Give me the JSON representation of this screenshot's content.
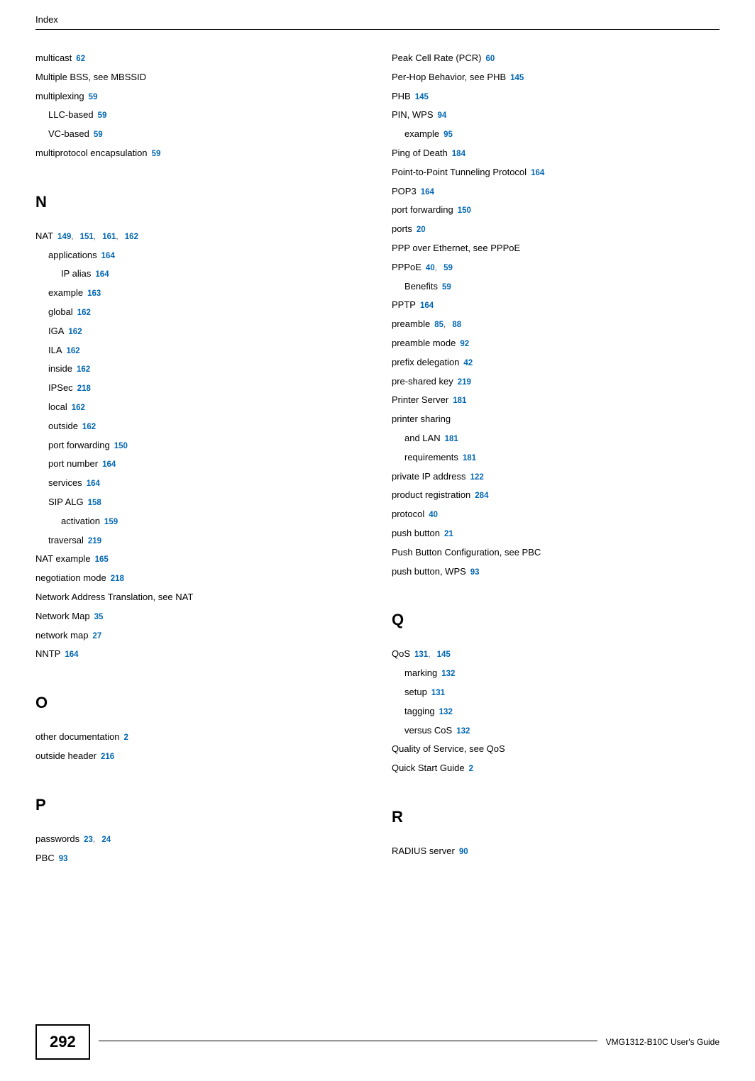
{
  "header": "Index",
  "footer": {
    "pageNumber": "292",
    "guide": "VMG1312-B10C User's Guide"
  },
  "leftColumn": [
    {
      "text": "multicast",
      "pages": [
        "62"
      ],
      "indent": 0
    },
    {
      "text": "Multiple BSS, see MBSSID",
      "pages": [],
      "indent": 0
    },
    {
      "text": "multiplexing",
      "pages": [
        "59"
      ],
      "indent": 0
    },
    {
      "text": "LLC-based",
      "pages": [
        "59"
      ],
      "indent": 1
    },
    {
      "text": "VC-based",
      "pages": [
        "59"
      ],
      "indent": 1
    },
    {
      "text": "multiprotocol encapsulation",
      "pages": [
        "59"
      ],
      "indent": 0
    },
    {
      "type": "letter",
      "text": "N"
    },
    {
      "text": "NAT",
      "pages": [
        "149",
        "151",
        "161",
        "162"
      ],
      "indent": 0
    },
    {
      "text": "applications",
      "pages": [
        "164"
      ],
      "indent": 1
    },
    {
      "text": "IP alias",
      "pages": [
        "164"
      ],
      "indent": 2
    },
    {
      "text": "example",
      "pages": [
        "163"
      ],
      "indent": 1
    },
    {
      "text": "global",
      "pages": [
        "162"
      ],
      "indent": 1
    },
    {
      "text": "IGA",
      "pages": [
        "162"
      ],
      "indent": 1
    },
    {
      "text": "ILA",
      "pages": [
        "162"
      ],
      "indent": 1
    },
    {
      "text": "inside",
      "pages": [
        "162"
      ],
      "indent": 1
    },
    {
      "text": "IPSec",
      "pages": [
        "218"
      ],
      "indent": 1
    },
    {
      "text": "local",
      "pages": [
        "162"
      ],
      "indent": 1
    },
    {
      "text": "outside",
      "pages": [
        "162"
      ],
      "indent": 1
    },
    {
      "text": "port forwarding",
      "pages": [
        "150"
      ],
      "indent": 1
    },
    {
      "text": "port number",
      "pages": [
        "164"
      ],
      "indent": 1
    },
    {
      "text": "services",
      "pages": [
        "164"
      ],
      "indent": 1
    },
    {
      "text": "SIP ALG",
      "pages": [
        "158"
      ],
      "indent": 1
    },
    {
      "text": "activation",
      "pages": [
        "159"
      ],
      "indent": 2
    },
    {
      "text": "traversal",
      "pages": [
        "219"
      ],
      "indent": 1
    },
    {
      "text": "NAT example",
      "pages": [
        "165"
      ],
      "indent": 0
    },
    {
      "text": "negotiation mode",
      "pages": [
        "218"
      ],
      "indent": 0
    },
    {
      "text": "Network Address Translation, see NAT",
      "pages": [],
      "indent": 0
    },
    {
      "text": "Network Map",
      "pages": [
        "35"
      ],
      "indent": 0
    },
    {
      "text": "network map",
      "pages": [
        "27"
      ],
      "indent": 0
    },
    {
      "text": "NNTP",
      "pages": [
        "164"
      ],
      "indent": 0
    },
    {
      "type": "letter",
      "text": "O"
    },
    {
      "text": "other documentation",
      "pages": [
        "2"
      ],
      "indent": 0
    },
    {
      "text": "outside header",
      "pages": [
        "216"
      ],
      "indent": 0
    },
    {
      "type": "letter",
      "text": "P"
    },
    {
      "text": "passwords",
      "pages": [
        "23",
        "24"
      ],
      "indent": 0
    },
    {
      "text": "PBC",
      "pages": [
        "93"
      ],
      "indent": 0
    }
  ],
  "rightColumn": [
    {
      "text": "Peak Cell Rate (PCR)",
      "pages": [
        "60"
      ],
      "indent": 0
    },
    {
      "text": "Per-Hop Behavior, see PHB",
      "pages": [
        "145"
      ],
      "indent": 0
    },
    {
      "text": "PHB",
      "pages": [
        "145"
      ],
      "indent": 0
    },
    {
      "text": "PIN, WPS",
      "pages": [
        "94"
      ],
      "indent": 0
    },
    {
      "text": "example",
      "pages": [
        "95"
      ],
      "indent": 1
    },
    {
      "text": "Ping of Death",
      "pages": [
        "184"
      ],
      "indent": 0
    },
    {
      "text": "Point-to-Point Tunneling Protocol",
      "pages": [
        "164"
      ],
      "indent": 0
    },
    {
      "text": "POP3",
      "pages": [
        "164"
      ],
      "indent": 0
    },
    {
      "text": "port forwarding",
      "pages": [
        "150"
      ],
      "indent": 0
    },
    {
      "text": "ports",
      "pages": [
        "20"
      ],
      "indent": 0
    },
    {
      "text": "PPP over Ethernet, see PPPoE",
      "pages": [],
      "indent": 0
    },
    {
      "text": "PPPoE",
      "pages": [
        "40",
        "59"
      ],
      "indent": 0
    },
    {
      "text": "Benefits",
      "pages": [
        "59"
      ],
      "indent": 1
    },
    {
      "text": "PPTP",
      "pages": [
        "164"
      ],
      "indent": 0
    },
    {
      "text": "preamble",
      "pages": [
        "85",
        "88"
      ],
      "indent": 0
    },
    {
      "text": "preamble mode",
      "pages": [
        "92"
      ],
      "indent": 0
    },
    {
      "text": "prefix delegation",
      "pages": [
        "42"
      ],
      "indent": 0
    },
    {
      "text": "pre-shared key",
      "pages": [
        "219"
      ],
      "indent": 0
    },
    {
      "text": "Printer Server",
      "pages": [
        "181"
      ],
      "indent": 0
    },
    {
      "text": "printer sharing",
      "pages": [],
      "indent": 0
    },
    {
      "text": "and LAN",
      "pages": [
        "181"
      ],
      "indent": 1
    },
    {
      "text": "requirements",
      "pages": [
        "181"
      ],
      "indent": 1
    },
    {
      "text": "private IP address",
      "pages": [
        "122"
      ],
      "indent": 0
    },
    {
      "text": "product registration",
      "pages": [
        "284"
      ],
      "indent": 0
    },
    {
      "text": "protocol",
      "pages": [
        "40"
      ],
      "indent": 0
    },
    {
      "text": "push button",
      "pages": [
        "21"
      ],
      "indent": 0
    },
    {
      "text": "Push Button Configuration, see PBC",
      "pages": [],
      "indent": 0
    },
    {
      "text": "push button, WPS",
      "pages": [
        "93"
      ],
      "indent": 0
    },
    {
      "type": "letter",
      "text": "Q"
    },
    {
      "text": "QoS",
      "pages": [
        "131",
        "145"
      ],
      "indent": 0
    },
    {
      "text": "marking",
      "pages": [
        "132"
      ],
      "indent": 1
    },
    {
      "text": "setup",
      "pages": [
        "131"
      ],
      "indent": 1
    },
    {
      "text": "tagging",
      "pages": [
        "132"
      ],
      "indent": 1
    },
    {
      "text": "versus CoS",
      "pages": [
        "132"
      ],
      "indent": 1
    },
    {
      "text": "Quality of Service, see QoS",
      "pages": [],
      "indent": 0
    },
    {
      "text": "Quick Start Guide",
      "pages": [
        "2"
      ],
      "indent": 0
    },
    {
      "type": "letter",
      "text": "R"
    },
    {
      "text": "RADIUS server",
      "pages": [
        "90"
      ],
      "indent": 0
    }
  ]
}
